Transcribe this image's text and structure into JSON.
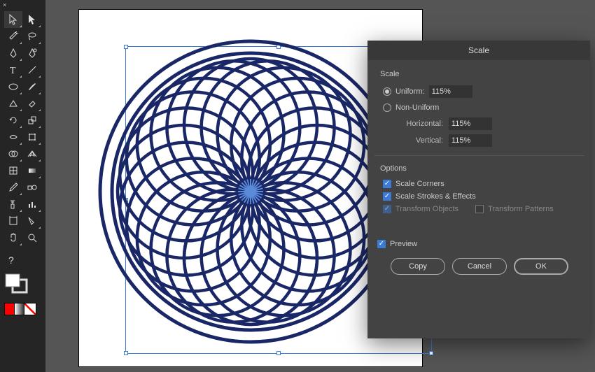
{
  "dialog": {
    "title": "Scale",
    "section_scale": "Scale",
    "uniform_label": "Uniform:",
    "uniform_value": "115%",
    "nonuniform_label": "Non-Uniform",
    "horizontal_label": "Horizontal:",
    "horizontal_value": "115%",
    "vertical_label": "Vertical:",
    "vertical_value": "115%",
    "section_options": "Options",
    "scale_corners": "Scale Corners",
    "scale_strokes": "Scale Strokes & Effects",
    "transform_objects": "Transform Objects",
    "transform_patterns": "Transform Patterns",
    "preview": "Preview",
    "copy": "Copy",
    "cancel": "Cancel",
    "ok": "OK"
  },
  "tools": {
    "close": "×",
    "help": "?"
  }
}
